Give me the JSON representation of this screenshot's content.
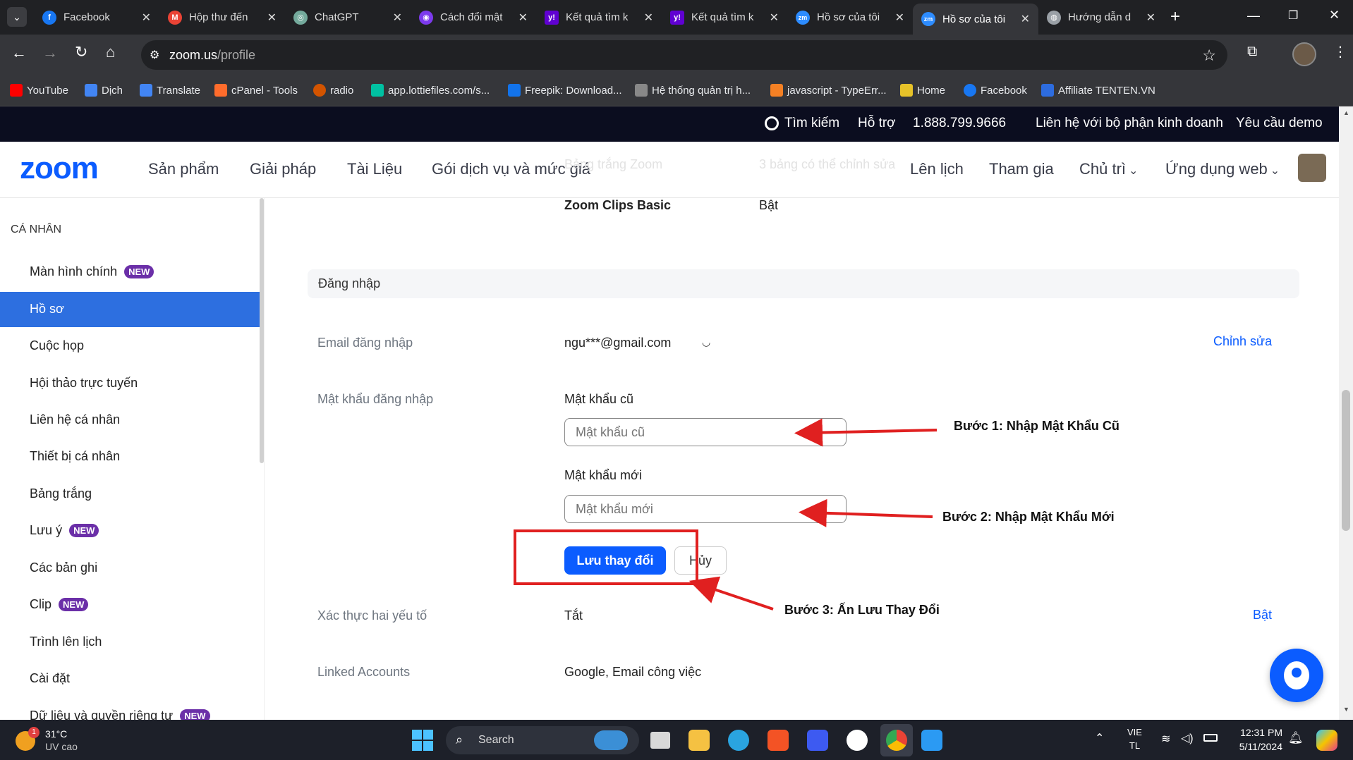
{
  "browser": {
    "tabs": [
      {
        "title": "Facebook",
        "color": "#1877f2",
        "glyph": "f"
      },
      {
        "title": "Hộp thư đến",
        "color": "#ea4335",
        "glyph": "M"
      },
      {
        "title": "ChatGPT",
        "color": "#74aa9c",
        "glyph": "◎"
      },
      {
        "title": "Cách đổi mật",
        "color": "#7c3aed",
        "glyph": "◉"
      },
      {
        "title": "Kết quả tìm k",
        "color": "#6001d2",
        "glyph": "y!"
      },
      {
        "title": "Kết quả tìm k",
        "color": "#6001d2",
        "glyph": "y!"
      },
      {
        "title": "Hồ sơ của tôi",
        "color": "#2d8cff",
        "glyph": "zm"
      },
      {
        "title": "Hồ sơ của tôi",
        "color": "#2d8cff",
        "glyph": "zm"
      },
      {
        "title": "Hướng dẫn d",
        "color": "#9aa0a6",
        "glyph": "◍"
      }
    ],
    "new_tab": "+",
    "url_host": "zoom.us",
    "url_path": "/profile",
    "bookmarks": [
      {
        "label": "YouTube",
        "color": "#ff0000"
      },
      {
        "label": "Dịch",
        "color": "#4285f4"
      },
      {
        "label": "Translate",
        "color": "#4285f4"
      },
      {
        "label": "cPanel - Tools",
        "color": "#ff6c2c"
      },
      {
        "label": "radio",
        "color": "#d35400"
      },
      {
        "label": "app.lottiefiles.com/s...",
        "color": "#00c1a2"
      },
      {
        "label": "Freepik: Download...",
        "color": "#1273eb"
      },
      {
        "label": "Hệ thống quản trị h...",
        "color": "#888888"
      },
      {
        "label": "javascript - TypeErr...",
        "color": "#f48024"
      },
      {
        "label": "Home",
        "color": "#e6c229"
      },
      {
        "label": "Facebook",
        "color": "#1877f2"
      },
      {
        "label": "Affiliate TENTEN.VN",
        "color": "#2d6cdf"
      }
    ]
  },
  "zoom_top": {
    "search": "Tìm kiếm",
    "support": "Hỗ trợ",
    "phone": "1.888.799.9666",
    "contact_sales": "Liên hệ với bộ phận kinh doanh",
    "demo": "Yêu cầu demo"
  },
  "zoom_nav": {
    "logo": "zoom",
    "products": "Sản phẩm",
    "solutions": "Giải pháp",
    "resources": "Tài Liệu",
    "plans": "Gói dịch vụ và mức giá",
    "schedule": "Lên lịch",
    "join": "Tham gia",
    "host": "Chủ trì",
    "web_app": "Ứng dụng web",
    "faded_left": "Bảng trắng Zoom",
    "faded_right": "3 bảng có thể chỉnh sửa"
  },
  "sidebar": {
    "heading": "CÁ NHÂN",
    "new_badge": "NEW",
    "items": [
      {
        "label": "Màn hình chính",
        "new": true
      },
      {
        "label": "Hồ sơ",
        "active": true
      },
      {
        "label": "Cuộc họp"
      },
      {
        "label": "Hội thảo trực tuyến"
      },
      {
        "label": "Liên hệ cá nhân"
      },
      {
        "label": "Thiết bị cá nhân"
      },
      {
        "label": "Bảng trắng"
      },
      {
        "label": "Lưu ý",
        "new": true
      },
      {
        "label": "Các bản ghi"
      },
      {
        "label": "Clip",
        "new": true
      },
      {
        "label": "Trình lên lịch"
      },
      {
        "label": "Cài đặt"
      },
      {
        "label": "Dữ liệu và quyền riêng tư",
        "new": true
      }
    ]
  },
  "main": {
    "clips_label": "Zoom Clips Basic",
    "clips_value": "Bật",
    "section_title": "Đăng nhập",
    "email_label": "Email đăng nhập",
    "email_value": "ngu***@gmail.com",
    "email_edit": "Chỉnh sửa",
    "password_label": "Mật khẩu đăng nhập",
    "old_password_label": "Mật khẩu cũ",
    "old_password_placeholder": "Mật khẩu cũ",
    "new_password_label": "Mật khẩu mới",
    "new_password_placeholder": "Mật khẩu mới",
    "save_button": "Lưu thay đổi",
    "cancel_button": "Hủy",
    "twofa_label": "Xác thực hai yếu tố",
    "twofa_value": "Tắt",
    "twofa_action": "Bật",
    "linked_label": "Linked Accounts",
    "linked_value": "Google, Email công việc"
  },
  "annotations": {
    "step1": "Bước 1: Nhập Mật Khẩu Cũ",
    "step2": "Bước 2: Nhập Mật Khẩu Mới",
    "step3": "Bước 3: Ấn Lưu Thay Đổi"
  },
  "taskbar": {
    "temperature": "31°C",
    "weather": "UV cao",
    "weather_badge": "1",
    "search": "Search",
    "lang_top": "VIE",
    "lang_bottom": "TL",
    "time": "12:31 PM",
    "date": "5/11/2024"
  },
  "colors": {
    "zoom_blue": "#0b5cff",
    "active_sidebar": "#2d6fe0",
    "annotation_red": "#e02020"
  }
}
